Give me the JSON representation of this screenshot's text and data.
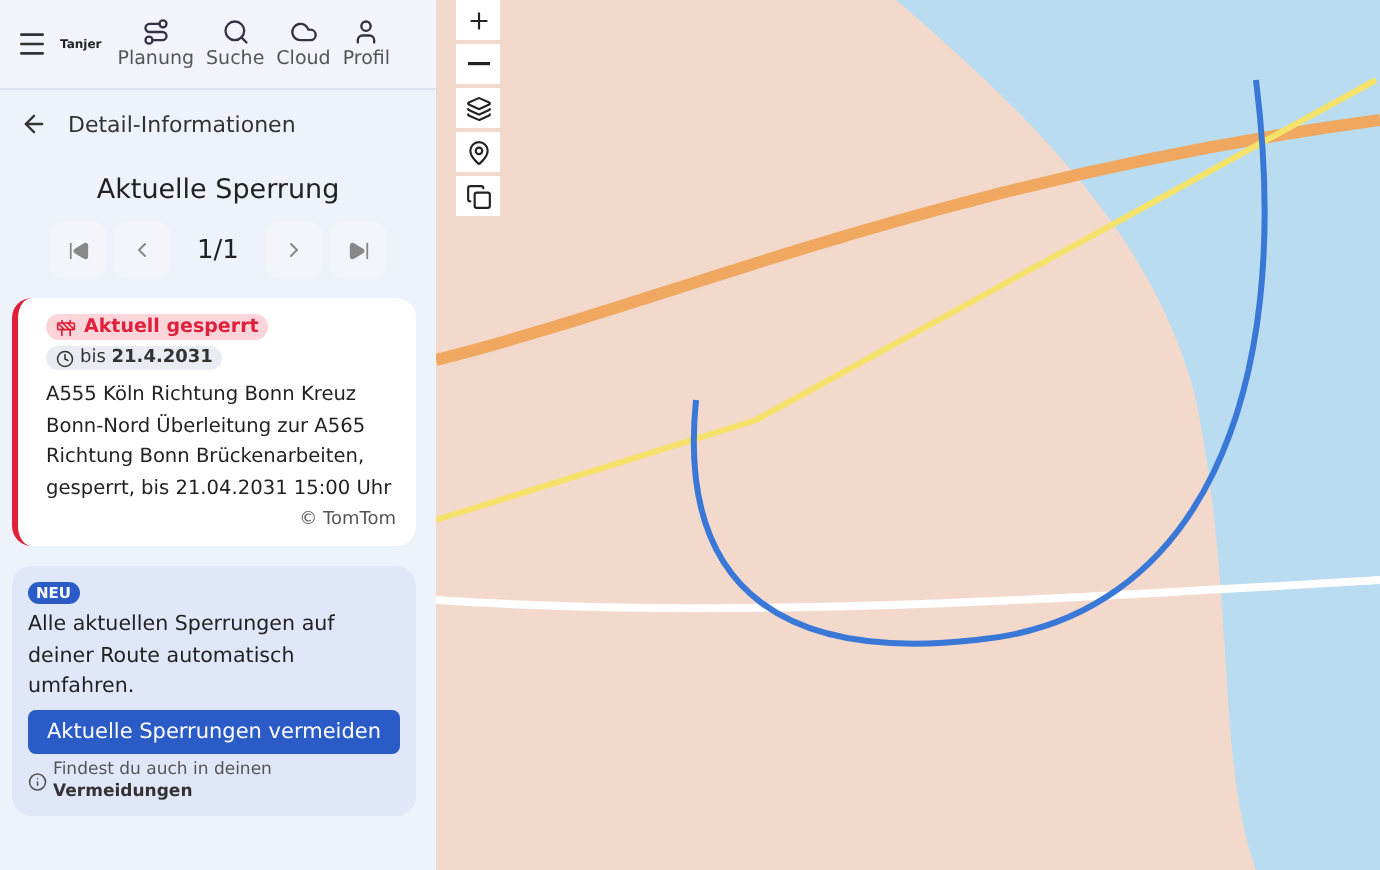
{
  "header": {
    "logo": "Tanjer",
    "nav": [
      {
        "label": "Planung",
        "kind": "route"
      },
      {
        "label": "Suche",
        "kind": "search"
      },
      {
        "label": "Cloud",
        "kind": "cloud"
      },
      {
        "label": "Profil",
        "kind": "profile"
      }
    ]
  },
  "detail": {
    "back_label": "Detail-Informationen",
    "title": "Aktuelle Sperrung",
    "pager": "1/1"
  },
  "closure": {
    "status": "Aktuell gesperrt",
    "until": "bis **21.4.2031**",
    "description": "A555 Köln Richtung Bonn Kreuz Bonn-Nord Überleitung zur A565 Richtung Bonn Brückenarbeiten, gesperrt, bis 21.04.2031 15:00 Uhr",
    "source": "© TomTom"
  },
  "promo": {
    "badge": "NEU",
    "text": "Alle aktuellen Sperrungen auf deiner Route automatisch umfahren.",
    "button": "Aktuelle Sperrungen vermeiden",
    "hint": "Findest du auch in deinen **Vermeidungen**"
  },
  "map_controls": [
    {
      "kind": "zoom-in"
    },
    {
      "kind": "zoom-out"
    },
    {
      "kind": "layers"
    },
    {
      "kind": "pin"
    },
    {
      "kind": "overlay"
    }
  ]
}
